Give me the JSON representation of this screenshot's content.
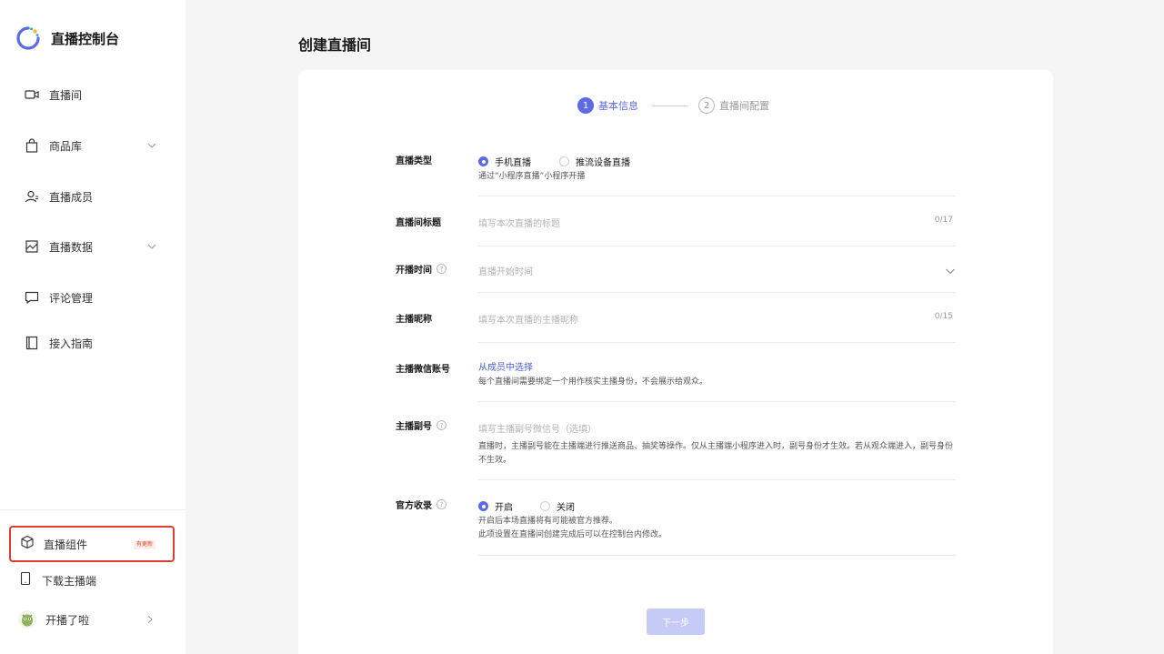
{
  "brand": {
    "title": "直播控制台",
    "icon": "spinner-logo-icon"
  },
  "sidebar": {
    "items": [
      {
        "label": "直播间",
        "icon": "video-camera-icon",
        "expandable": false
      },
      {
        "label": "商品库",
        "icon": "shopping-bag-icon",
        "expandable": true
      },
      {
        "label": "直播成员",
        "icon": "users-icon",
        "expandable": false
      },
      {
        "label": "直播数据",
        "icon": "chart-image-icon",
        "expandable": true
      },
      {
        "label": "评论管理",
        "icon": "comment-icon",
        "expandable": false
      },
      {
        "label": "接入指南",
        "icon": "book-icon",
        "expandable": false
      }
    ],
    "bottom": {
      "component": {
        "label": "直播组件",
        "badge": "有更新",
        "icon": "cube-icon"
      },
      "download": {
        "label": "下载主播端",
        "icon": "mobile-phone-icon"
      },
      "user": {
        "label": "开播了啦",
        "icon": "user-avatar-icon"
      }
    }
  },
  "page": {
    "title": "创建直播间"
  },
  "steps": [
    {
      "num": "1",
      "label": "基本信息",
      "active": true
    },
    {
      "num": "2",
      "label": "直播间配置",
      "active": false
    }
  ],
  "form": {
    "live_type": {
      "label": "直播类型",
      "options": [
        {
          "label": "手机直播",
          "selected": true
        },
        {
          "label": "推流设备直播",
          "selected": false
        }
      ],
      "hint": "通过“小程序直播”小程序开播"
    },
    "title": {
      "label": "直播间标题",
      "placeholder": "填写本次直播的标题",
      "counter": "0/17"
    },
    "start_time": {
      "label": "开播时间",
      "help": "?",
      "placeholder": "直播开始时间"
    },
    "nickname": {
      "label": "主播昵称",
      "placeholder": "填写本次直播的主播昵称",
      "counter": "0/15"
    },
    "wechat": {
      "label": "主播微信账号",
      "link": "从成员中选择",
      "hint": "每个直播间需要绑定一个用作核实主播身份，不会展示给观众。"
    },
    "sub_account": {
      "label": "主播副号",
      "help": "?",
      "placeholder": "填写主播副号微信号（选填）",
      "hint": "直播时，主播副号能在主播端进行推送商品、抽奖等操作。仅从主播端小程序进入时，副号身份才生效。若从观众端进入，副号身份不生效。"
    },
    "official": {
      "label": "官方收录",
      "help": "?",
      "options": [
        {
          "label": "开启",
          "selected": true
        },
        {
          "label": "关闭",
          "selected": false
        }
      ],
      "hint1": "开启后本场直播将有可能被官方推荐。",
      "hint2": "此项设置在直播间创建完成后可以在控制台内修改。"
    }
  },
  "next_button": "下一步",
  "colors": {
    "accent": "#5b6be8",
    "highlight_border": "#e23b2f",
    "button_disabled": "#c5cbf6"
  }
}
